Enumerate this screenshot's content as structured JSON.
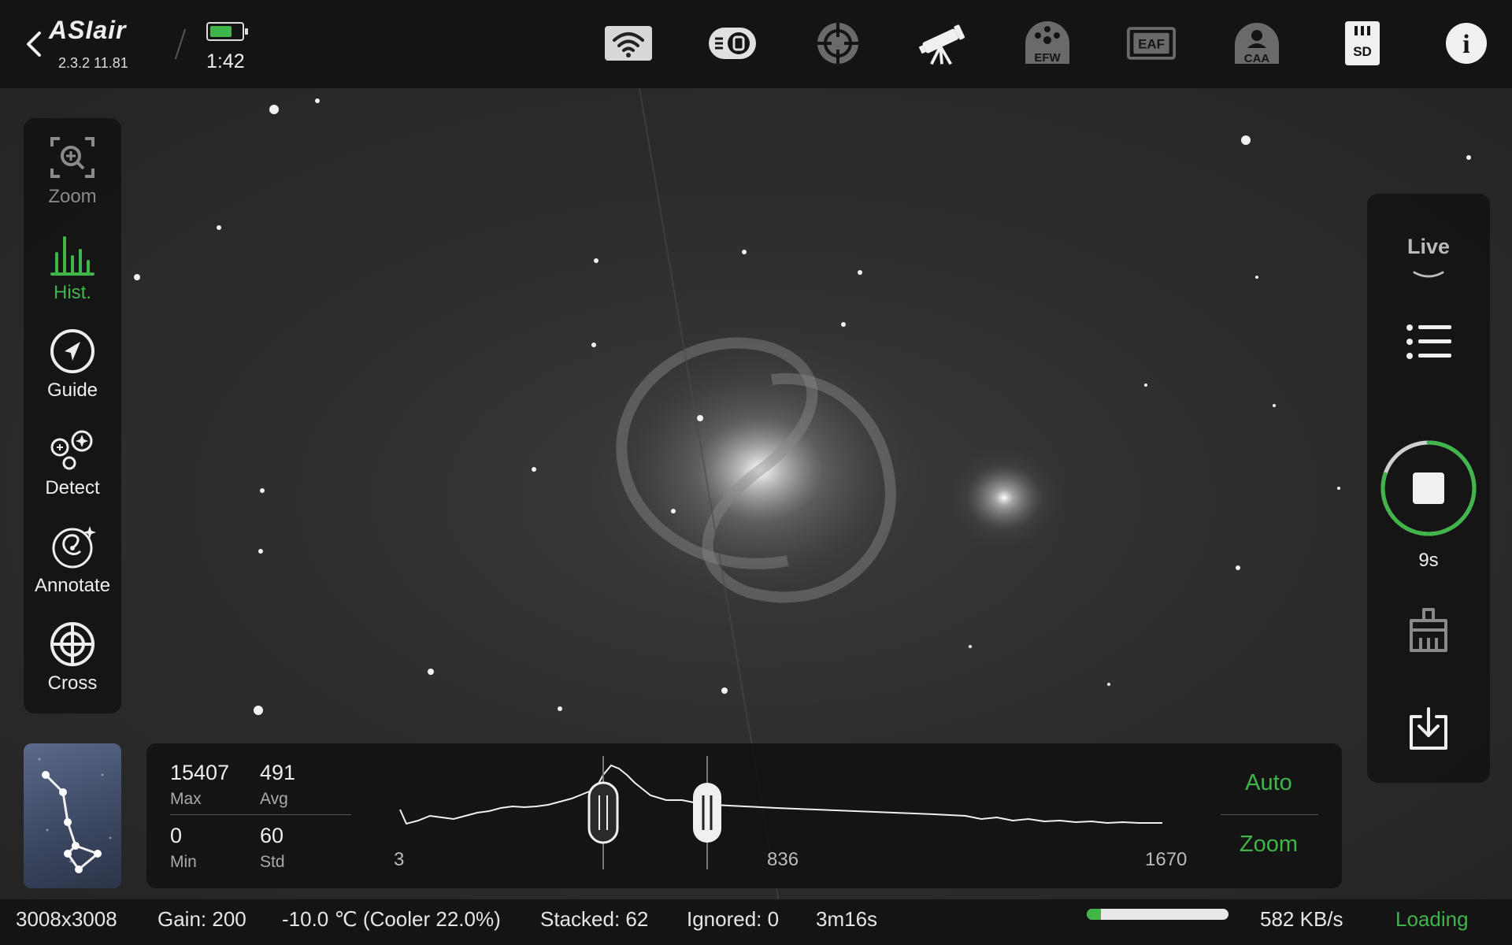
{
  "header": {
    "logo": "ASIair",
    "version": "2.3.2 11.81",
    "time": "1:42",
    "battery_level": 0.7,
    "icons": [
      "wifi-icon",
      "power-icon",
      "guide-scope-icon",
      "telescope-icon",
      "efw-icon",
      "eaf-icon",
      "caa-icon",
      "sd-card-icon",
      "info-icon"
    ],
    "efw_label": "EFW",
    "eaf_label": "EAF",
    "caa_label": "CAA",
    "sd_label": "SD",
    "info_label": "i"
  },
  "left_tools": [
    {
      "label": "Zoom",
      "icon": "zoom-icon",
      "active": false
    },
    {
      "label": "Hist.",
      "icon": "histogram-icon",
      "active": true
    },
    {
      "label": "Guide",
      "icon": "guide-icon",
      "active": false
    },
    {
      "label": "Detect",
      "icon": "detect-icon",
      "active": false
    },
    {
      "label": "Annotate",
      "icon": "annotate-icon",
      "active": false
    },
    {
      "label": "Cross",
      "icon": "crosshair-icon",
      "active": false
    }
  ],
  "right_panel": {
    "mode_label": "Live",
    "exposure_timer": "9s",
    "exposure_progress": 0.8
  },
  "histogram": {
    "max_value": "15407",
    "max_label": "Max",
    "avg_value": "491",
    "avg_label": "Avg",
    "min_value": "0",
    "min_label": "Min",
    "std_value": "60",
    "std_label": "Std",
    "tick_start": "3",
    "tick_mid": "836",
    "tick_end": "1670",
    "auto_label": "Auto",
    "zoom_label": "Zoom"
  },
  "status": {
    "resolution": "3008x3008",
    "gain": "Gain: 200",
    "temperature": "-10.0 ℃ (Cooler 22.0%)",
    "stacked": "Stacked: 62",
    "ignored": "Ignored: 0",
    "elapsed": "3m16s",
    "download_progress": 0.1,
    "speed": "582 KB/s",
    "state": "Loading"
  },
  "colors": {
    "accent": "#3fb54a",
    "panel": "#121212",
    "sky": "#2e2e2e"
  }
}
